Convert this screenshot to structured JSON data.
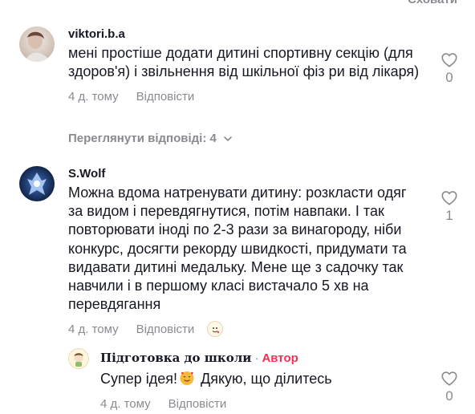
{
  "header": {
    "hide_label": "Сховати"
  },
  "comments": [
    {
      "username": "viktori.b.a",
      "text": "мені простіше додати дитині спортивну секцію (для здоров'я) і звільнення від шкільної фіз ри від лікаря)",
      "date": "4 д. тому",
      "reply_label": "Відповісти",
      "likes": "0",
      "view_replies": "Переглянути відповіді: 4"
    },
    {
      "username": "S.Wolf",
      "text": "Можна вдома натренувати дитину: розкласти одяг за видом і перевдягнутися, потім навпаки. І так повторювати іноді по 2-3 рази за винагороду, ніби конкурс, досягти рекорду швидкості, придумати та видавати дитині медальку. Мене ще з садочку так навчили і в першому класі вистачало 5 хв на перевдягання",
      "date": "4 д. тому",
      "reply_label": "Відповісти",
      "likes": "1"
    }
  ],
  "reply": {
    "username": "Підготовка до школи",
    "separator": "·",
    "author_badge": "Автор",
    "text_before": "Супер ідея!",
    "text_after": " Дякую, що ділитесь",
    "date": "4 д. тому",
    "reply_label": "Відповісти",
    "likes": "0"
  },
  "icons": {
    "like": "heart-outline-icon",
    "chevron": "chevron-down-icon",
    "emoji": "smiling-face-with-hearts-icon"
  },
  "colors": {
    "secondary_text": "#8a8b91",
    "primary_text": "#161823",
    "author_badge": "#fe2c55"
  }
}
